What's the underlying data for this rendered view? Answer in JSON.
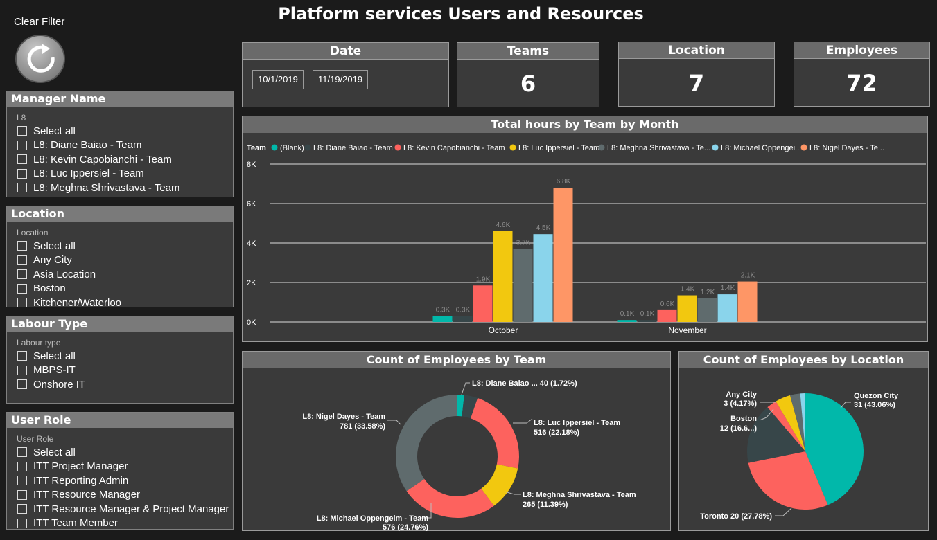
{
  "title": "Platform services Users and Resources",
  "clear_filter": {
    "label": "Clear Filter",
    "icon": "refresh-icon"
  },
  "slicers": {
    "manager": {
      "title": "Manager Name",
      "sub": "L8",
      "items": [
        "Select all",
        "L8: Diane Baiao - Team",
        "L8: Kevin Capobianchi - Team",
        "L8: Luc Ippersiel - Team",
        "L8: Meghna Shrivastava - Team"
      ]
    },
    "location": {
      "title": "Location",
      "sub": "Location",
      "items": [
        "Select all",
        "Any City",
        "Asia Location",
        "Boston",
        "Kitchener/Waterloo"
      ]
    },
    "labour": {
      "title": "Labour Type",
      "sub": "Labour type",
      "items": [
        "Select all",
        "MBPS-IT",
        "Onshore IT"
      ]
    },
    "role": {
      "title": "User Role",
      "sub": "User Role",
      "items": [
        "Select all",
        "ITT Project Manager",
        "ITT Reporting Admin",
        "ITT Resource Manager",
        "ITT Resource Manager & Project Manager",
        "ITT Team Member"
      ]
    }
  },
  "date": {
    "title": "Date",
    "start": "10/1/2019",
    "end": "11/19/2019"
  },
  "kpis": {
    "teams": {
      "title": "Teams",
      "value": "6"
    },
    "location": {
      "title": "Location",
      "value": "7"
    },
    "employees": {
      "title": "Employees",
      "value": "72"
    }
  },
  "colors": {
    "blank": "#01b8aa",
    "diane": "#374649",
    "kevin": "#fd625e",
    "luc": "#f2c80f",
    "meghna": "#5f6b6d",
    "michael": "#8ad4eb",
    "nigel": "#fe9666"
  },
  "chart_data": [
    {
      "type": "bar",
      "title": "Total hours by Team by Month",
      "legend_title": "Team",
      "legend_placement": "top",
      "categories": [
        "October",
        "November"
      ],
      "ylim": [
        0,
        8000
      ],
      "yticks": [
        "0K",
        "2K",
        "4K",
        "6K",
        "8K"
      ],
      "series": [
        {
          "name": "(Blank)",
          "values": [
            300,
            100
          ],
          "labels": [
            "0.3K",
            "0.1K"
          ]
        },
        {
          "name": "L8: Diane Baiao - Team",
          "values": [
            300,
            100
          ],
          "labels": [
            "0.3K",
            "0.1K"
          ]
        },
        {
          "name": "L8: Kevin Capobianchi - Team",
          "values": [
            1850,
            600
          ],
          "labels": [
            "1.9K",
            "0.6K"
          ]
        },
        {
          "name": "L8: Luc Ippersiel - Team",
          "values": [
            4600,
            1350
          ],
          "labels": [
            "4.6K",
            "1.4K"
          ]
        },
        {
          "name": "L8: Meghna Shrivastava - Team",
          "values": [
            3700,
            1200
          ],
          "labels": [
            "3.7K",
            "1.2K"
          ]
        },
        {
          "name": "L8: Michael Oppengeim - Team",
          "values": [
            4450,
            1400
          ],
          "labels": [
            "4.5K",
            "1.4K"
          ]
        },
        {
          "name": "L8: Nigel Dayes - Team",
          "values": [
            6800,
            2050
          ],
          "labels": [
            "6.8K",
            "2.1K"
          ]
        }
      ],
      "legend_labels": [
        "(Blank)",
        "L8: Diane Baiao - Team",
        "L8: Kevin Capobianchi - Team",
        "L8: Luc Ippersiel - Team",
        "L8: Meghna Shrivastava - Te...",
        "L8: Michael Oppengei...",
        "L8: Nigel Dayes - Te..."
      ]
    },
    {
      "type": "pie",
      "variant": "donut",
      "title": "Count of Employees by Team",
      "slices": [
        {
          "name": "L8: Diane Baiao ...",
          "value": 40,
          "label": "L8: Diane Baiao ... 40 (1.72%)",
          "color_key": "blank"
        },
        {
          "name": "(unlabeled)",
          "value": 80,
          "color_key": "diane"
        },
        {
          "name": "L8: Luc Ippersiel - Team",
          "value": 516,
          "label": "516 (22.18%)",
          "color_key": "kevin"
        },
        {
          "name": "L8: Meghna Shrivastava - Team",
          "value": 265,
          "label": "265 (11.39%)",
          "color_key": "luc"
        },
        {
          "name": "L8: Michael Oppengeim - Team",
          "value": 576,
          "label": "576 (24.76%)",
          "color_key": "kevin"
        },
        {
          "name": "L8: Nigel Dayes - Team",
          "value": 781,
          "label": "781 (33.58%)",
          "color_key": "meghna"
        }
      ]
    },
    {
      "type": "pie",
      "title": "Count of Employees by Location",
      "slices": [
        {
          "name": "Quezon City",
          "value": 31,
          "label": "31 (43.06%)",
          "color_key": "blank"
        },
        {
          "name": "Toronto",
          "value": 20,
          "label": "Toronto 20 (27.78%)",
          "color_key": "kevin"
        },
        {
          "name": "Boston",
          "value": 12,
          "label": "12 (16.6...)",
          "color_key": "diane"
        },
        {
          "name": "(unlabeled)",
          "value": 2,
          "color_key": "kevin"
        },
        {
          "name": "Any City",
          "value": 3,
          "label": "3 (4.17%)",
          "color_key": "luc"
        },
        {
          "name": "(unlabeled)",
          "value": 2,
          "color_key": "meghna"
        },
        {
          "name": "(unlabeled)",
          "value": 1,
          "color_key": "michael"
        }
      ]
    }
  ]
}
